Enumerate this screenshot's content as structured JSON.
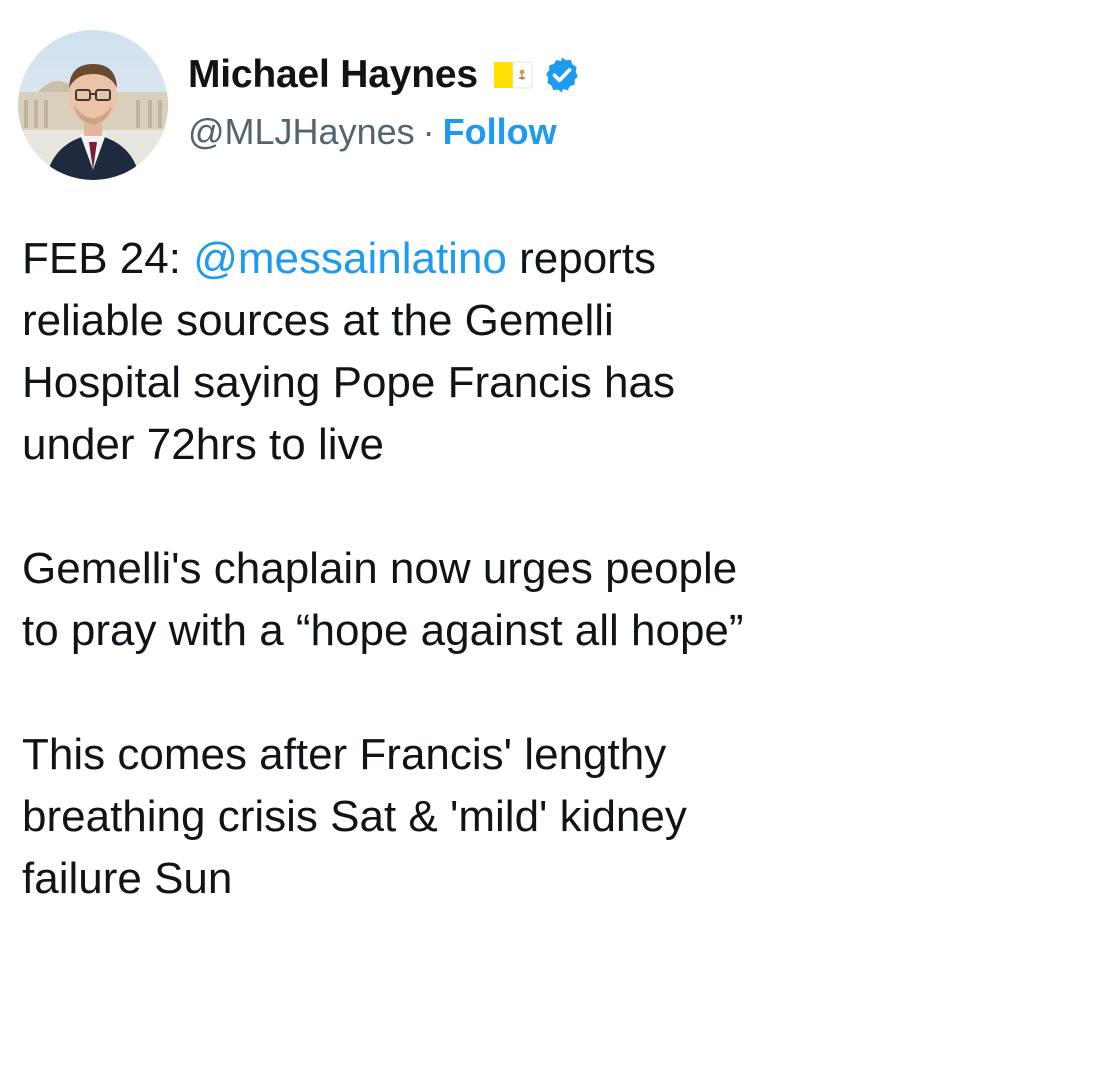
{
  "author": {
    "display_name": "Michael Haynes",
    "handle": "@MLJHaynes",
    "separator": "·",
    "follow_label": "Follow",
    "flag_icon": "vatican-flag-icon",
    "verified_icon": "verified-badge-icon",
    "verified_color": "#1d9bf0"
  },
  "tweet": {
    "p1": {
      "prefix": "FEB 24: ",
      "mention": "@messainlatino",
      "l1_suffix": " reports",
      "l2": "reliable sources at the Gemelli",
      "l3": "Hospital saying Pope Francis has",
      "l4": "under 72hrs to live"
    },
    "p2": {
      "l1": "Gemelli's chaplain now urges people",
      "l2": "to pray with a “hope against all hope”"
    },
    "p3": {
      "l1": "This comes after Francis' lengthy",
      "l2": "breathing crisis Sat & 'mild' kidney",
      "l3": "failure Sun"
    }
  },
  "colors": {
    "text": "#0f1419",
    "secondary": "#536471",
    "link": "#1d9bf0"
  }
}
